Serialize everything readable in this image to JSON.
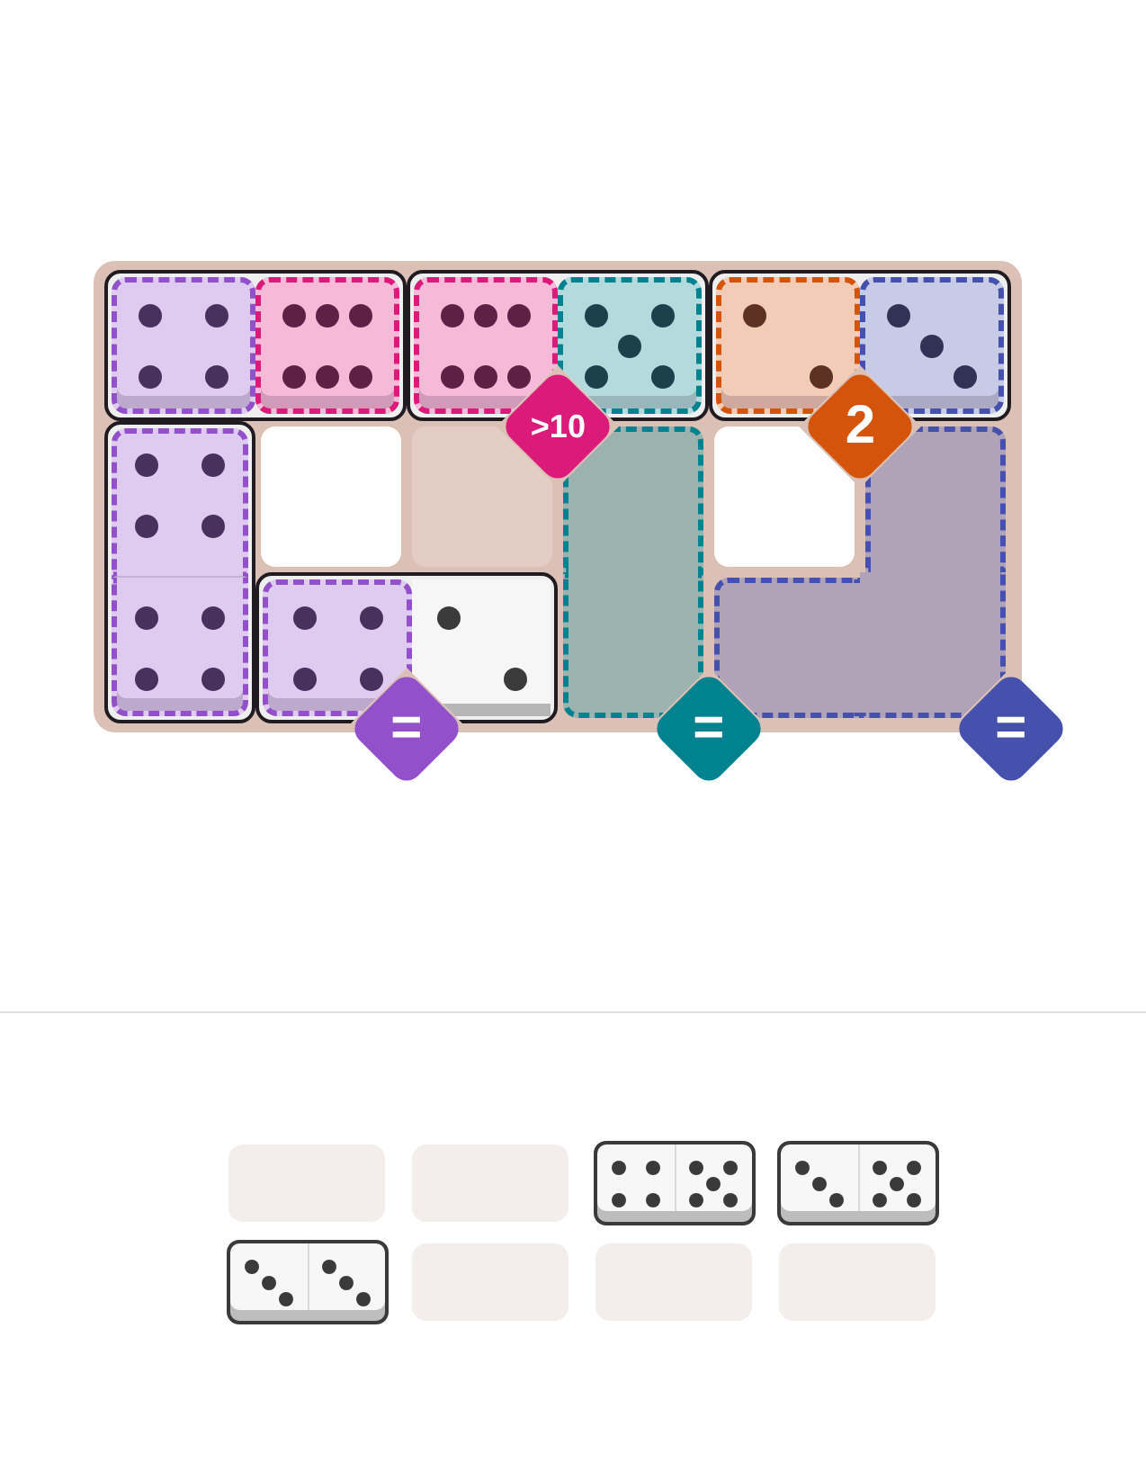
{
  "board": {
    "rows": [
      [
        {
          "kind": "horizontal_domino",
          "halves": [
            {
              "kind": "four",
              "color": "#9251ca",
              "shaded": false
            },
            {
              "kind": "six",
              "color": "#dc1a7a",
              "shaded": false
            }
          ]
        },
        {
          "kind": "horizontal_domino",
          "halves": [
            {
              "kind": "six",
              "color": "#dc1a7a",
              "constraint": ">10",
              "shaded": false
            },
            {
              "kind": "five",
              "color": "#00838f",
              "shaded": false
            }
          ]
        },
        {
          "kind": "horizontal_domino",
          "halves": [
            {
              "kind": "two",
              "color": "#d3540a",
              "constraint": "2",
              "shaded": false
            },
            {
              "kind": "three",
              "color": "#4650ad",
              "shaded": false
            }
          ]
        }
      ],
      [
        {
          "kind": "vertical_domino",
          "halves": [
            {
              "kind": "four",
              "color": "#9251ca",
              "shaded": false
            },
            {
              "kind": "four",
              "color": "#9251ca",
              "shaded": false
            }
          ]
        },
        {
          "kind": "cell",
          "shaded": false
        },
        {
          "kind": "cell",
          "shaded": true
        },
        {
          "kind": "cell",
          "color": "#00838f",
          "shaded": false
        },
        {
          "kind": "cell",
          "shaded": false
        },
        {
          "kind": "cell",
          "color": "#4650ad",
          "shaded": false
        }
      ],
      [
        {
          "kind": "horizontal_domino",
          "halves": [
            {
              "kind": "four",
              "color": "#9251ca",
              "constraint": "=",
              "shaded": false
            },
            {
              "kind": "two",
              "shaded": false
            }
          ]
        },
        {
          "kind": "cell",
          "color": "#00838f",
          "constraint": "=",
          "shaded": false
        },
        {
          "kind": "cell",
          "color": "#4650ad",
          "shaded": false
        },
        {
          "kind": "cell",
          "color": "#4650ad",
          "constraint": "=",
          "shaded": false
        }
      ]
    ]
  },
  "tray": [
    {
      "kind": "empty"
    },
    {
      "kind": "empty"
    },
    {
      "kind": "domino",
      "halves": [
        {
          "kind": "four"
        },
        {
          "kind": "five"
        }
      ]
    },
    {
      "kind": "domino",
      "halves": [
        {
          "kind": "three"
        },
        {
          "kind": "five"
        }
      ]
    },
    {
      "kind": "domino",
      "halves": [
        {
          "kind": "three"
        },
        {
          "kind": "three"
        }
      ]
    },
    {
      "kind": "empty"
    },
    {
      "kind": "empty"
    },
    {
      "kind": "empty"
    }
  ]
}
